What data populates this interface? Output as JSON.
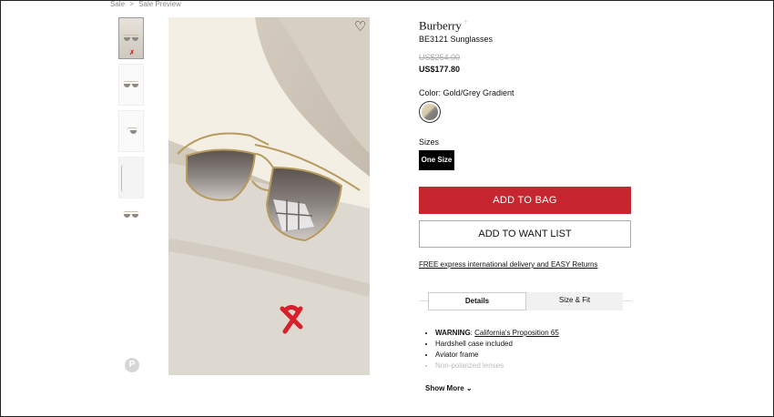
{
  "breadcrumb": [
    "Sale",
    ">",
    "Sale Preview"
  ],
  "product": {
    "brand": "Burberry",
    "brand_mark": "+",
    "name": "BE3121 Sunglasses",
    "original_price": "US$254.00",
    "sale_price": "US$177.80"
  },
  "color": {
    "label": "Color: Gold/Grey Gradient"
  },
  "sizes": {
    "label": "Sizes",
    "options": [
      "One Size"
    ]
  },
  "actions": {
    "add_to_bag": "ADD TO BAG",
    "add_to_want_list": "ADD TO WANT LIST"
  },
  "delivery_link": "FREE express international delivery and EASY Returns",
  "tabs": [
    "Details",
    "Size & Fit"
  ],
  "details": {
    "warning_label": "WARNING",
    "warning_link": "California's Proposition 65",
    "items": [
      "Hardshell case included",
      "Aviator frame",
      "Non-polarized lenses"
    ]
  },
  "show_more": "Show More",
  "icons": {
    "wishlist": "heart-icon",
    "pinterest": "pinterest-icon",
    "chevron": "chevron-down-icon"
  },
  "colors": {
    "accent": "#c6262f"
  }
}
